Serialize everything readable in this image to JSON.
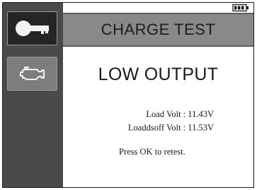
{
  "sidebar": {
    "items": [
      {
        "icon": "key-icon",
        "selected": true
      },
      {
        "icon": "engine-icon",
        "selected": false
      }
    ]
  },
  "status_bar": {
    "battery_icon": "battery-icon"
  },
  "header": {
    "title": "CHARGE TEST"
  },
  "result": {
    "status": "LOW OUTPUT"
  },
  "readings": {
    "load_volt": "Load Volt :  11.43V",
    "loadoff_volt": "Loaddsoff Volt :  11.53V"
  },
  "prompt": "Press OK to retest."
}
